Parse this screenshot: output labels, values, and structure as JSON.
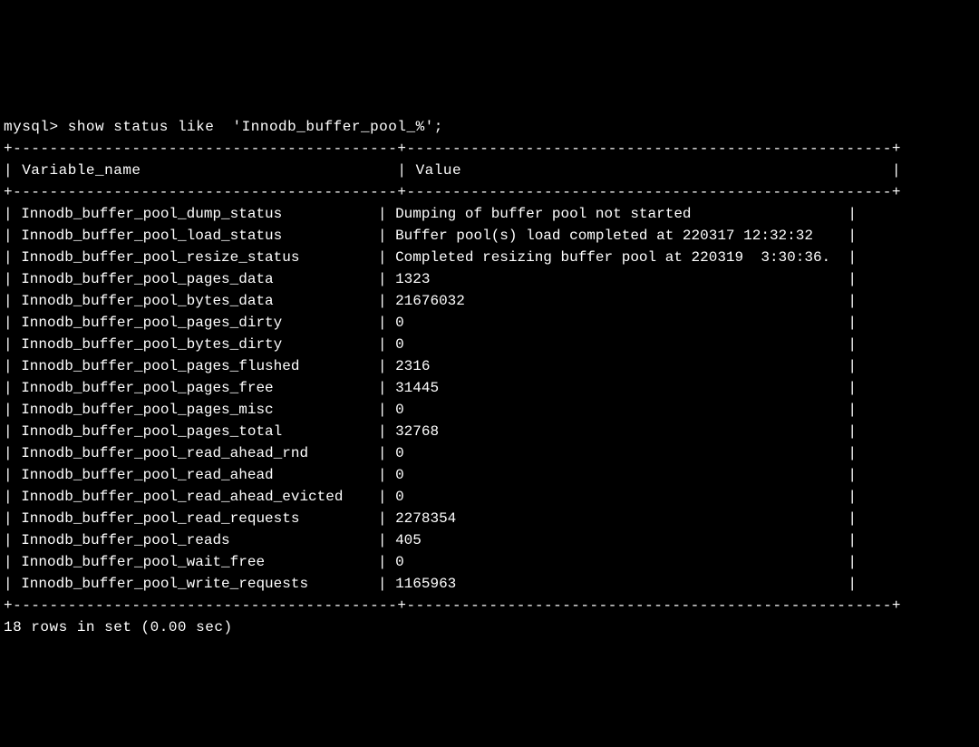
{
  "prompt": "mysql> ",
  "query": "show status like  'Innodb_buffer_pool_%';",
  "table": {
    "col1_header": "Variable_name",
    "col2_header": "Value",
    "border_top": "+------------------------------------------+-----------------------------------------------------+",
    "border_sep": "+------------------------------------------+-----------------------------------------------------+",
    "border_bot": "+------------------------------------------+-----------------------------------------------------+",
    "rows": [
      {
        "name": "Innodb_buffer_pool_dump_status",
        "value": "Dumping of buffer pool not started"
      },
      {
        "name": "Innodb_buffer_pool_load_status",
        "value": "Buffer pool(s) load completed at 220317 12:32:32"
      },
      {
        "name": "Innodb_buffer_pool_resize_status",
        "value": "Completed resizing buffer pool at 220319  3:30:36."
      },
      {
        "name": "Innodb_buffer_pool_pages_data",
        "value": "1323"
      },
      {
        "name": "Innodb_buffer_pool_bytes_data",
        "value": "21676032"
      },
      {
        "name": "Innodb_buffer_pool_pages_dirty",
        "value": "0"
      },
      {
        "name": "Innodb_buffer_pool_bytes_dirty",
        "value": "0"
      },
      {
        "name": "Innodb_buffer_pool_pages_flushed",
        "value": "2316"
      },
      {
        "name": "Innodb_buffer_pool_pages_free",
        "value": "31445"
      },
      {
        "name": "Innodb_buffer_pool_pages_misc",
        "value": "0"
      },
      {
        "name": "Innodb_buffer_pool_pages_total",
        "value": "32768"
      },
      {
        "name": "Innodb_buffer_pool_read_ahead_rnd",
        "value": "0"
      },
      {
        "name": "Innodb_buffer_pool_read_ahead",
        "value": "0"
      },
      {
        "name": "Innodb_buffer_pool_read_ahead_evicted",
        "value": "0"
      },
      {
        "name": "Innodb_buffer_pool_read_requests",
        "value": "2278354"
      },
      {
        "name": "Innodb_buffer_pool_reads",
        "value": "405"
      },
      {
        "name": "Innodb_buffer_pool_wait_free",
        "value": "0"
      },
      {
        "name": "Innodb_buffer_pool_write_requests",
        "value": "1165963"
      }
    ]
  },
  "footer": "18 rows in set (0.00 sec)"
}
